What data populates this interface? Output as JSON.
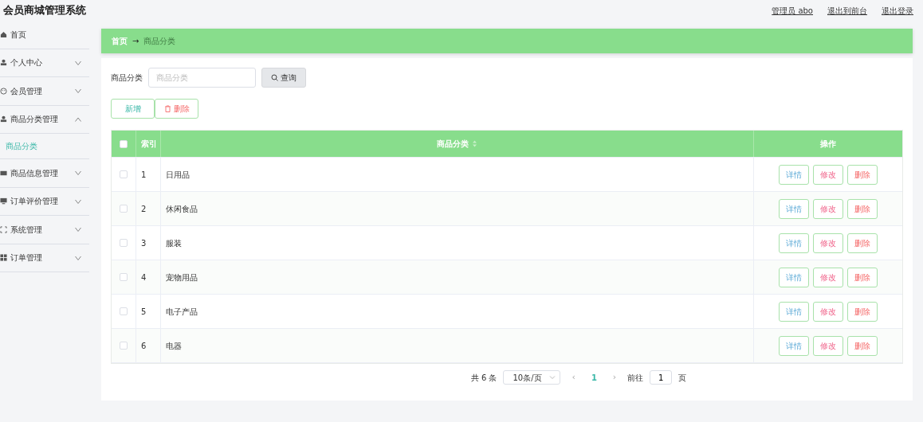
{
  "header": {
    "title": "会员商城管理系统",
    "links": [
      "管理员 abo",
      "退出到前台",
      "退出登录"
    ]
  },
  "sidebar": {
    "items": [
      {
        "label": "首页"
      },
      {
        "label": "个人中心",
        "expanded": false
      },
      {
        "label": "会员管理",
        "expanded": false
      },
      {
        "label": "商品分类管理",
        "expanded": true,
        "children": [
          {
            "label": "商品分类",
            "selected": true
          }
        ]
      },
      {
        "label": "商品信息管理",
        "expanded": false
      },
      {
        "label": "订单评价管理",
        "expanded": false
      },
      {
        "label": "系统管理",
        "expanded": false
      },
      {
        "label": "订单管理",
        "expanded": false
      }
    ]
  },
  "breadcrumb": [
    "首页",
    "→",
    "商品分类"
  ],
  "search": {
    "label": "商品分类",
    "placeholder": "商品分类",
    "button": "查询"
  },
  "actions": [
    {
      "label": "新增",
      "kind": "add"
    },
    {
      "label": "删除",
      "kind": "delete"
    }
  ],
  "table": {
    "columns": [
      "索引",
      "商品分类",
      "操作"
    ],
    "header_checked": false,
    "rows": [
      {
        "index": "1",
        "name": "日用品",
        "checked": false,
        "buttons": [
          {
            "label": "详情",
            "kind": "detail"
          },
          {
            "label": "修改",
            "kind": "edit"
          },
          {
            "label": "删除",
            "kind": "delete"
          }
        ]
      },
      {
        "index": "2",
        "name": "休闲食品",
        "checked": false,
        "buttons": [
          {
            "label": "详情",
            "kind": "detail"
          },
          {
            "label": "修改",
            "kind": "edit"
          },
          {
            "label": "删除",
            "kind": "delete"
          }
        ]
      },
      {
        "index": "3",
        "name": "服装",
        "checked": false,
        "buttons": [
          {
            "label": "详情",
            "kind": "detail"
          },
          {
            "label": "修改",
            "kind": "edit"
          },
          {
            "label": "删除",
            "kind": "delete"
          }
        ]
      },
      {
        "index": "4",
        "name": "宠物用品",
        "checked": false,
        "buttons": [
          {
            "label": "详情",
            "kind": "detail"
          },
          {
            "label": "修改",
            "kind": "edit"
          },
          {
            "label": "删除",
            "kind": "delete"
          }
        ]
      },
      {
        "index": "5",
        "name": "电子产品",
        "checked": false,
        "buttons": [
          {
            "label": "详情",
            "kind": "detail"
          },
          {
            "label": "修改",
            "kind": "edit"
          },
          {
            "label": "删除",
            "kind": "delete"
          }
        ]
      },
      {
        "index": "6",
        "name": "电器",
        "checked": false,
        "buttons": [
          {
            "label": "详情",
            "kind": "detail"
          },
          {
            "label": "修改",
            "kind": "edit"
          },
          {
            "label": "删除",
            "kind": "delete"
          }
        ]
      }
    ]
  },
  "pagination": {
    "total": "共 6 条",
    "page_size": "10条/页",
    "prev": "‹",
    "pages": [
      {
        "label": "1",
        "selected": true
      }
    ],
    "next": "›",
    "goto_label": "前往",
    "goto_value": "1",
    "goto_suffix": "页"
  }
}
